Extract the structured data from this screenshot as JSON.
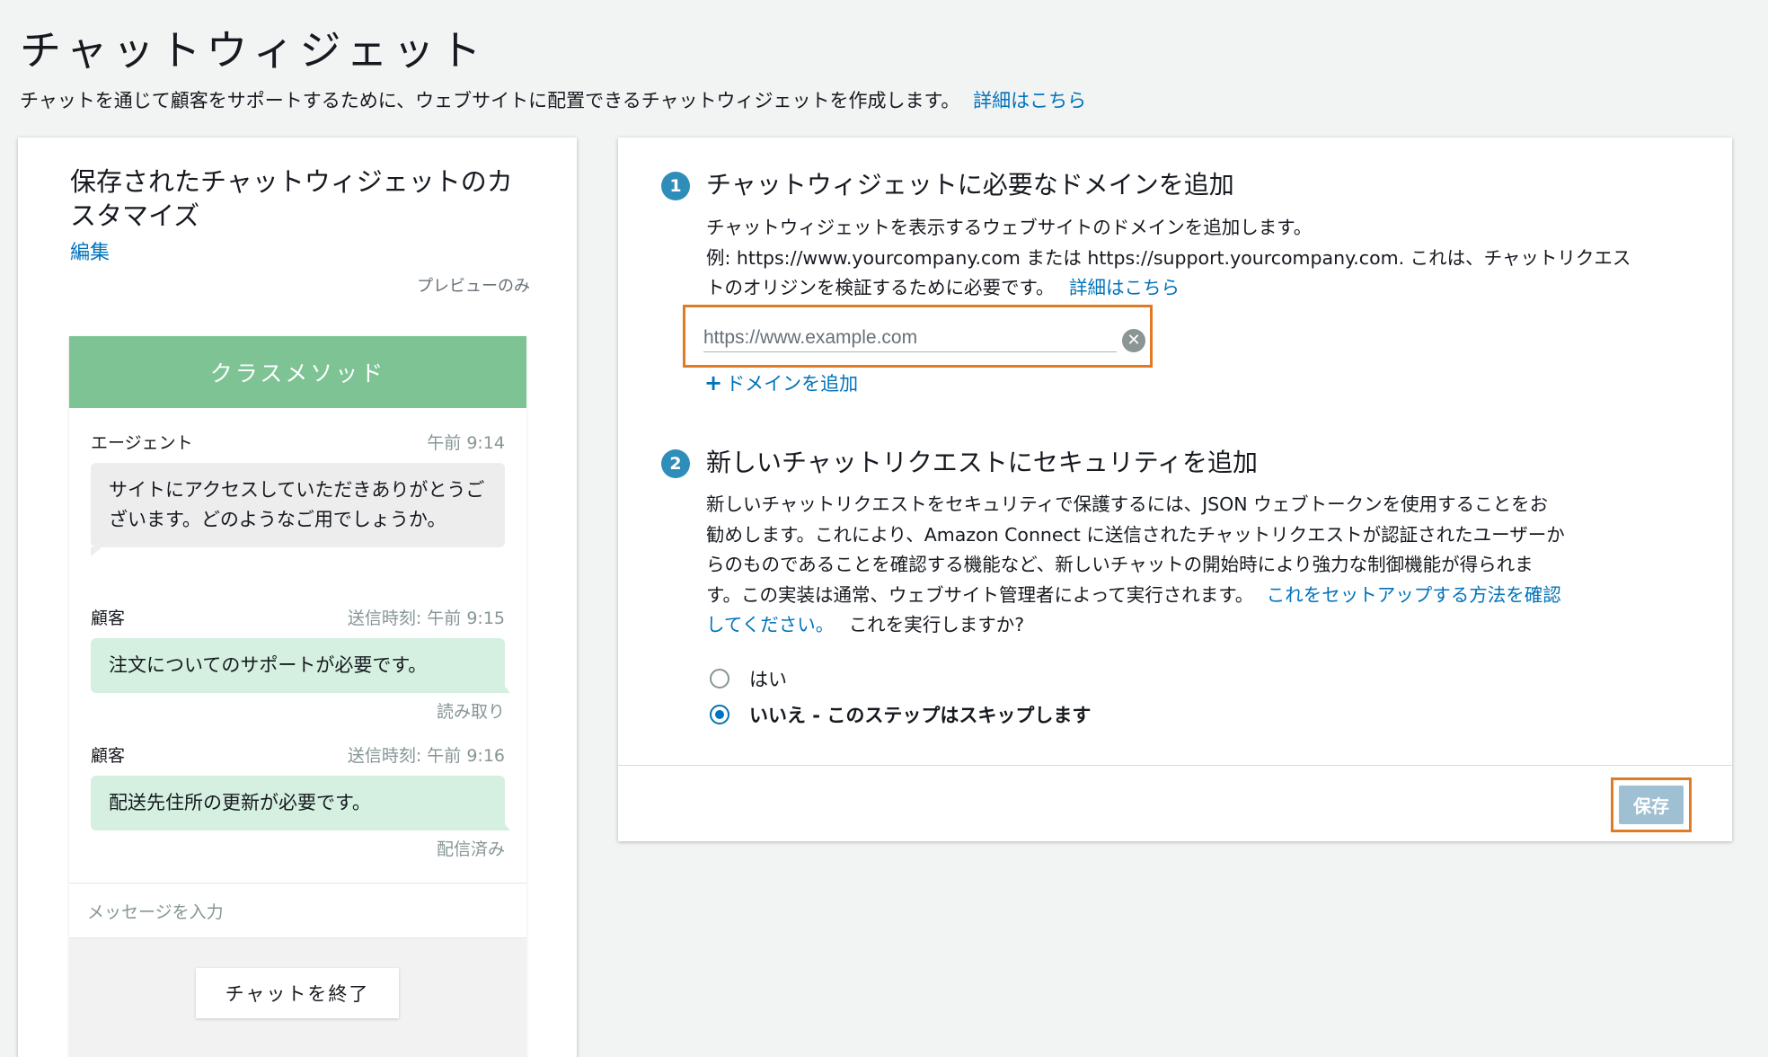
{
  "page": {
    "title": "チャットウィジェット",
    "description": "チャットを通じて顧客をサポートするために、ウェブサイトに配置できるチャットウィジェットを作成します。",
    "learn_more": "詳細はこちら"
  },
  "left_panel": {
    "title": "保存されたチャットウィジェットのカスタマイズ",
    "edit_link": "編集",
    "preview_only": "プレビューのみ",
    "widget": {
      "header": "クラスメソッド",
      "header_color": "#7dc394",
      "messages": [
        {
          "sender": "エージェント",
          "time": "午前 9:14",
          "text": "サイトにアクセスしていただきありがとうございます。どのようなご用でしょうか。",
          "status": ""
        },
        {
          "sender": "顧客",
          "time": "送信時刻: 午前 9:15",
          "text": "注文についてのサポートが必要です。",
          "status": "読み取り"
        },
        {
          "sender": "顧客",
          "time": "送信時刻: 午前 9:16",
          "text": "配送先住所の更新が必要です。",
          "status": "配信済み"
        }
      ],
      "input_placeholder": "メッセージを入力",
      "end_chat": "チャットを終了"
    }
  },
  "right_panel": {
    "step1": {
      "number": "1",
      "title": "チャットウィジェットに必要なドメインを追加",
      "body_line1": "チャットウィジェットを表示するウェブサイトのドメインを追加します。",
      "body_line2": "例: https://www.yourcompany.com または https://support.yourcompany.com. これは、チャットリクエス",
      "body_line3": "トのオリジンを検証するために必要です。",
      "learn_more": "詳細はこちら",
      "domain_placeholder": "https://www.example.com",
      "add_domain": "ドメインを追加"
    },
    "step2": {
      "number": "2",
      "title": "新しいチャットリクエストにセキュリティを追加",
      "body_line1": "新しいチャットリクエストをセキュリティで保護するには、JSON ウェブトークンを使用することをお",
      "body_line2": "勧めします。これにより、Amazon Connect に送信されたチャットリクエストが認証されたユーザーか",
      "body_line3": "らのものであることを確認する機能など、新しいチャットの開始時により強力な制御機能が得られま",
      "body_line4": "す。この実装は通常、ウェブサイト管理者によって実行されます。",
      "setup_link_part1": "これをセットアップする方法を確認",
      "setup_link_part2": "してください。",
      "question": "これを実行しますか?",
      "options": [
        {
          "label": "はい",
          "checked": false
        },
        {
          "label": "いいえ - このステップはスキップします",
          "checked": true
        }
      ]
    },
    "save_button": "保存",
    "accent_color": "#0073bb",
    "highlight_color": "#e07b24"
  }
}
